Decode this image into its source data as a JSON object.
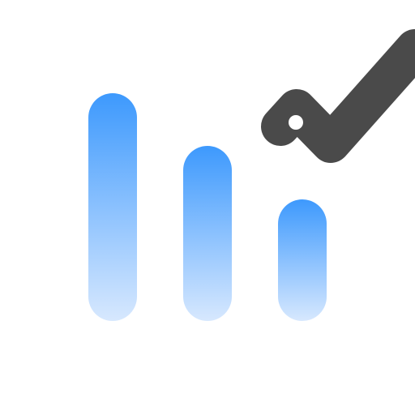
{
  "icon": {
    "background_color": "#ffffff",
    "bar_gradient_top_color": "#3d99fd",
    "bar_gradient_bottom_color": "#d7e8fe",
    "check_color": "#4a4a4a",
    "hole_color": "#ffffff",
    "bars": [
      {
        "name": "bar-tall",
        "relative_level": 1.0
      },
      {
        "name": "bar-medium",
        "relative_level": 0.77
      },
      {
        "name": "bar-short",
        "relative_level": 0.53
      }
    ]
  }
}
